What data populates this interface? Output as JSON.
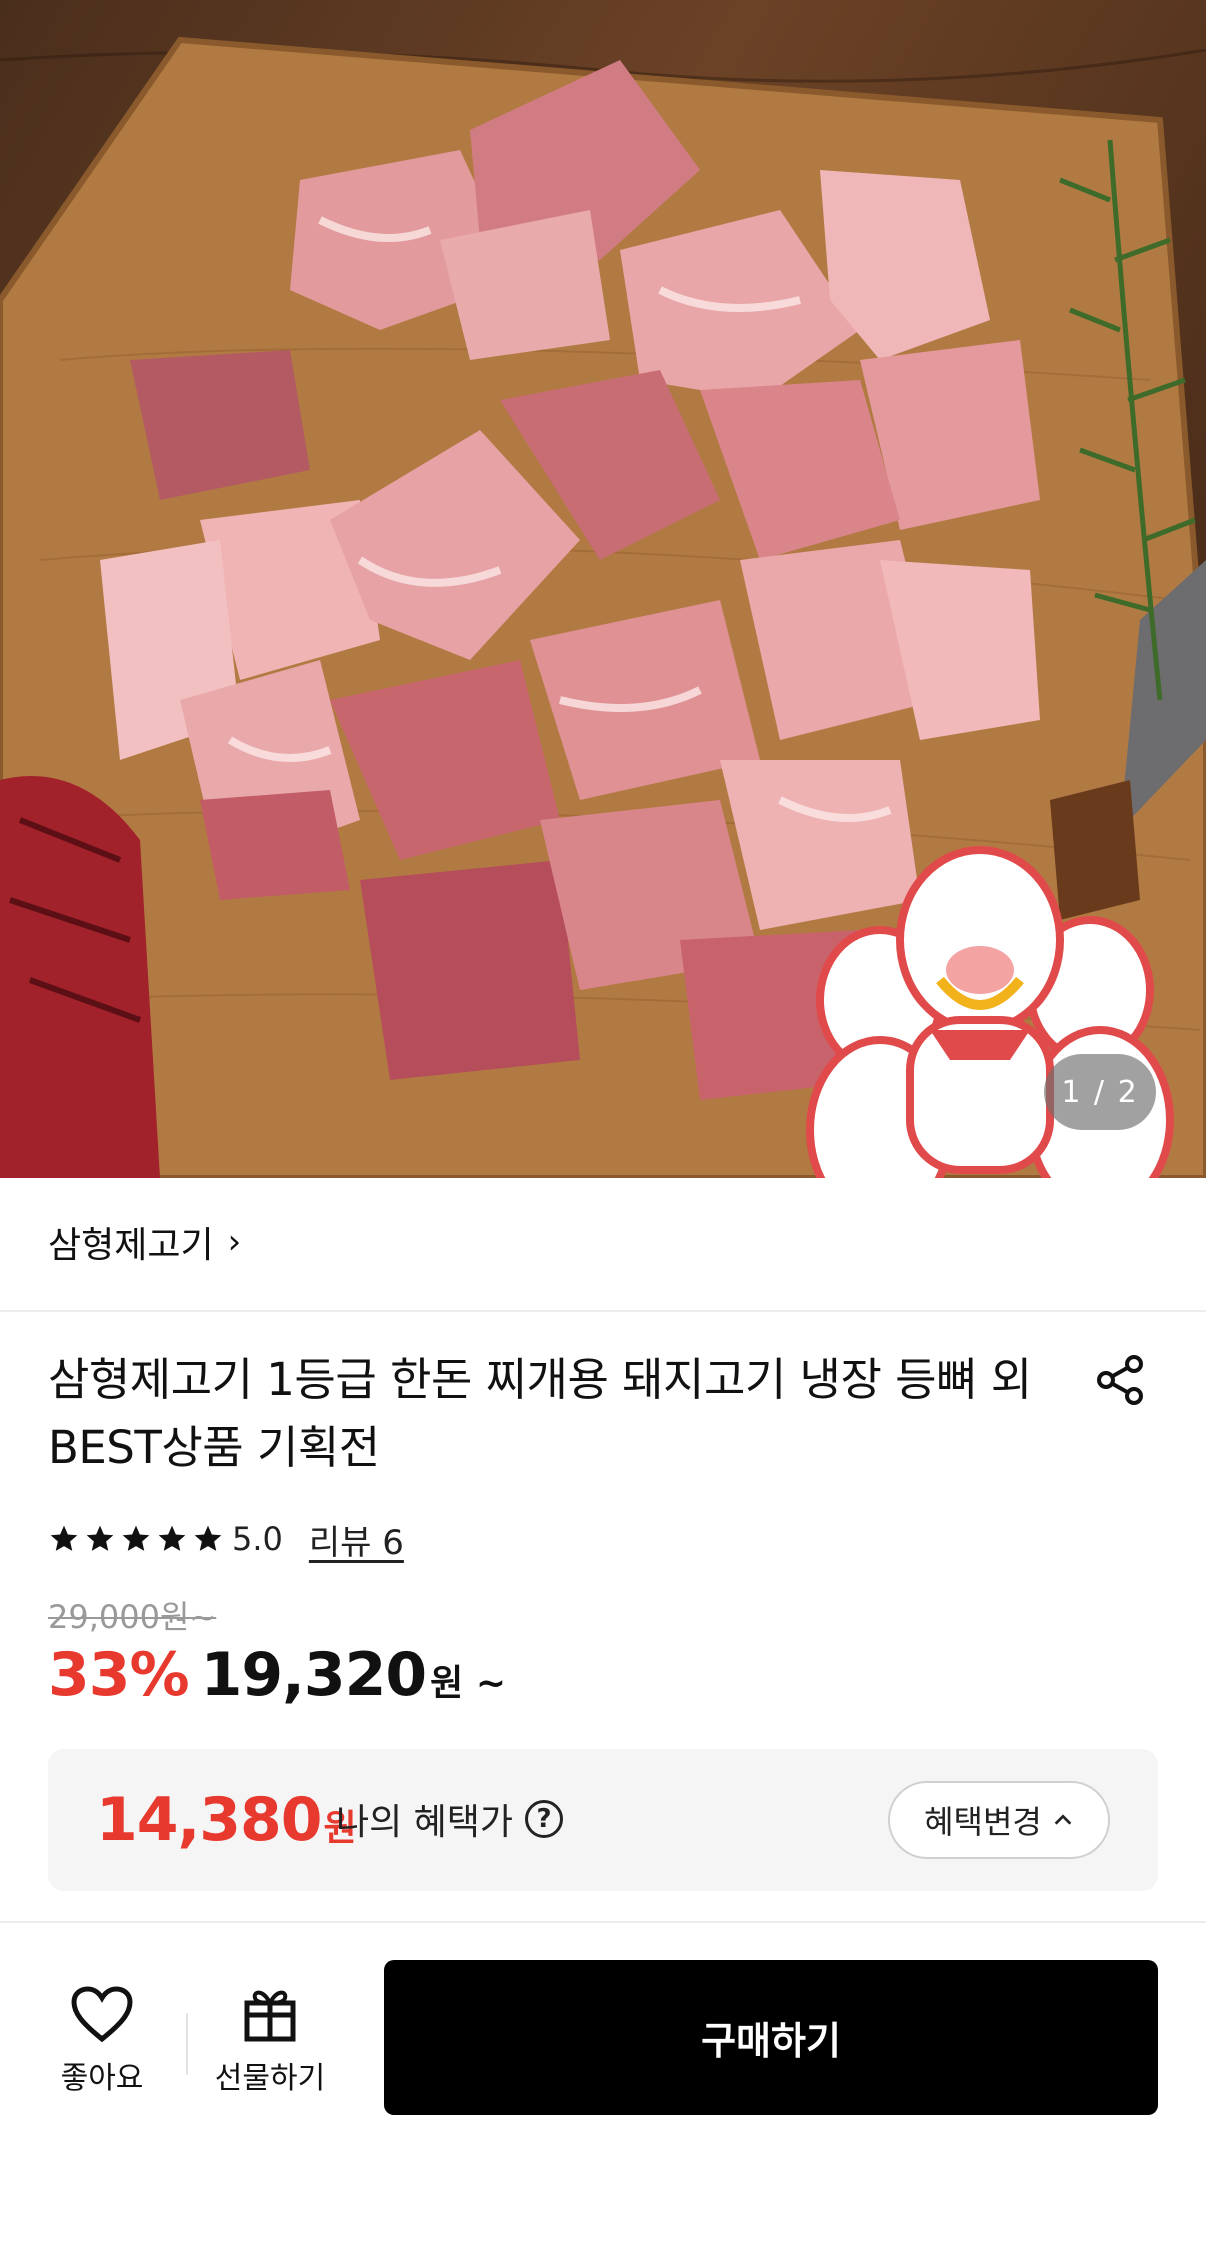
{
  "gallery": {
    "image_name": "product-photo-diced-pork-on-cutting-board",
    "current": "1",
    "total": "2",
    "indicator": "1 / 2"
  },
  "seller": {
    "name": "삼형제고기",
    "chevron": "›"
  },
  "product": {
    "title": "삼형제고기 1등급 한돈 찌개용 돼지고기 냉장 등뼈 외 BEST상품 기획전",
    "rating": 5.0,
    "rating_text": "5.0",
    "review_label": "리뷰 6"
  },
  "price": {
    "original": "29,000원",
    "original_suffix": "~",
    "discount": "33%",
    "sale": "19,320",
    "sale_unit": "원 ~"
  },
  "benefit": {
    "amount": "14,380",
    "unit": "원",
    "label": "나의 혜택가",
    "help": "?",
    "change_button": "혜택변경"
  },
  "bottom_bar": {
    "like_label": "좋아요",
    "gift_label": "선물하기",
    "buy_label": "구매하기"
  },
  "colors": {
    "accent": "#e8392f",
    "buy_button": "#000000",
    "benefit_bg": "#f5f5f5"
  }
}
